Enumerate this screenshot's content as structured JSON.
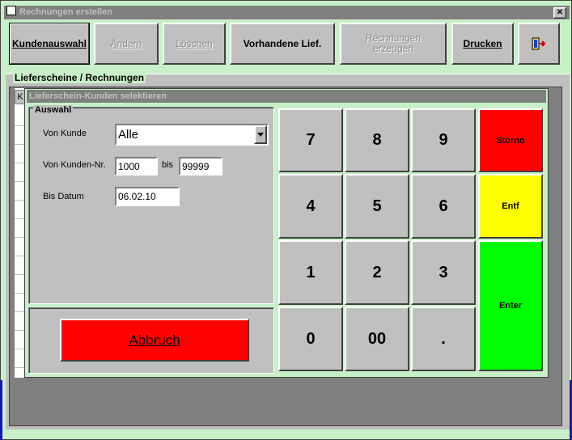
{
  "window": {
    "title": "Rechnungen erstellen",
    "close_symbol": "✕"
  },
  "toolbar": {
    "kundenauswahl": "Kundenauswahl",
    "aendern": "Ändern",
    "loeschen": "Löschen",
    "vorhandene": "Vorhandene Lief.",
    "rechnungen": "Rechnungen erzeugen",
    "drucken": "Drucken"
  },
  "section": {
    "label": "Lieferscheine / Rechnungen",
    "grid_first_header": "K"
  },
  "dialog": {
    "title": "Lieferschein-Kunden selektieren",
    "group_label": "Auswahl",
    "von_kunde_label": "Von Kunde",
    "von_kunde_value": "Alle",
    "von_kunden_nr_label": "Von Kunden-Nr.",
    "von_kunden_nr_value": "1000",
    "bis_label": "bis",
    "bis_value": "99999",
    "bis_datum_label": "Bis Datum",
    "bis_datum_value": "06.02.10",
    "abbruch_label": "Abbruch"
  },
  "keypad": {
    "keys": [
      "7",
      "8",
      "9",
      "4",
      "5",
      "6",
      "1",
      "2",
      "3",
      "0",
      "00",
      "."
    ],
    "storno": "Storno",
    "entf": "Entf",
    "enter": "Enter"
  },
  "colors": {
    "green_bg": "#c8f0c8",
    "storno": "#ff0000",
    "entf": "#ffff00",
    "enter": "#00ff00",
    "abbruch": "#ff0000"
  }
}
